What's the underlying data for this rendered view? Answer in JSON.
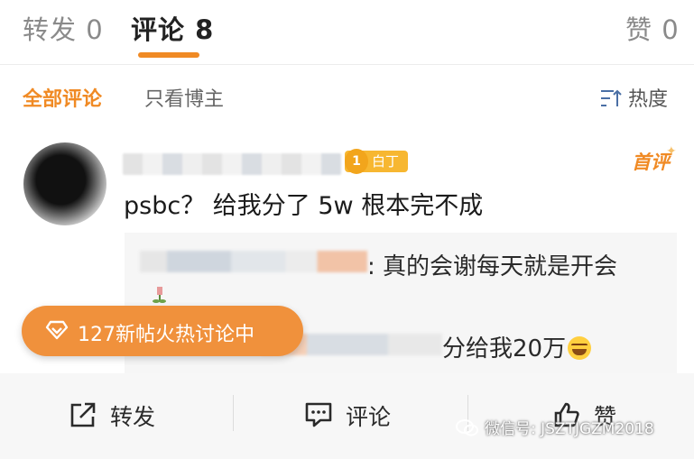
{
  "tabs": {
    "repost": "转发 0",
    "comments": "评论 8",
    "likes": "赞 0"
  },
  "filters": {
    "all": "全部评论",
    "author_only": "只看博主",
    "sort": "热度"
  },
  "comment": {
    "level_num": "1",
    "level_label": "白丁",
    "first_tag": "首评",
    "text": "psbc？ 给我分了 5w 根本完不成",
    "reply1": ": 真的会谢每天就是开会",
    "reply2": "分给我20万"
  },
  "hot_pill": "127新帖火热讨论中",
  "actions": {
    "repost": "转发",
    "comment": "评论",
    "like": "赞"
  },
  "watermark": "微信号: JSZTJGZM2018",
  "colors": {
    "accent": "#f08a24",
    "badge": "#f7b731",
    "pill": "#f0913c"
  }
}
